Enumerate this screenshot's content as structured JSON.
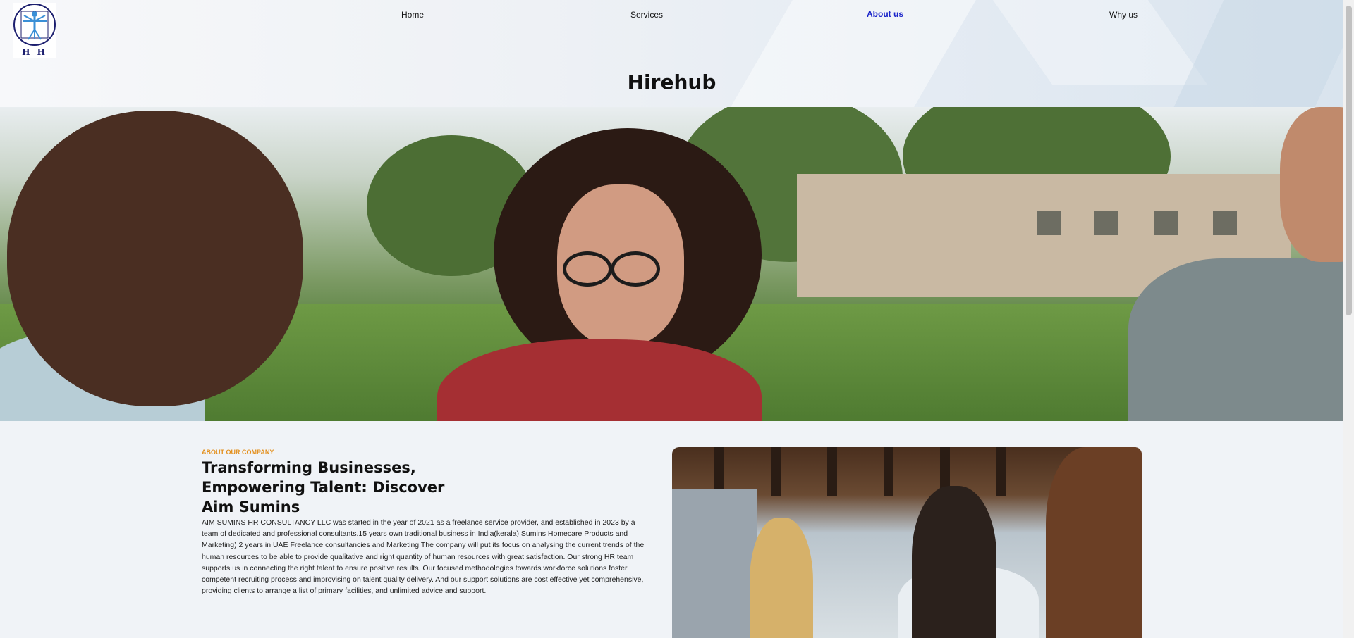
{
  "brand": {
    "logo_text": "H H"
  },
  "nav": {
    "items": [
      {
        "label": "Home",
        "active": false
      },
      {
        "label": "Services",
        "active": false
      },
      {
        "label": "About us",
        "active": true
      },
      {
        "label": "Why us",
        "active": false
      }
    ]
  },
  "header": {
    "title": "Hirehub"
  },
  "about": {
    "kicker": "ABOUT OUR COMPANY",
    "heading": "Transforming Businesses, Empowering Talent: Discover Aim Sumins",
    "body": "AIM SUMINS HR CONSULTANCY LLC was started in the year of 2021 as a freelance service provider, and established in 2023 by a team of dedicated and professional consultants.15 years own traditional business in India(kerala) Sumins Homecare Products and Marketing) 2 years in UAE Freelance consultancies and Marketing The company will put its focus on analysing the current trends of the human resources to be able to provide qualitative and right quantity of human resources with great satisfaction. Our strong HR team supports us in connecting the right talent to ensure positive results. Our focused methodologies towards workforce solutions foster competent recruiting process and improvising on talent quality delivery. And our support solutions are cost effective yet comprehensive, providing clients to arrange a list of primary facilities, and unlimited advice and support."
  },
  "colors": {
    "accent": "#e3901e",
    "nav_active": "#1a23c9",
    "logo": "#1b1e6e"
  },
  "icons": {
    "logo": "vitruvian-man-logo-icon"
  }
}
